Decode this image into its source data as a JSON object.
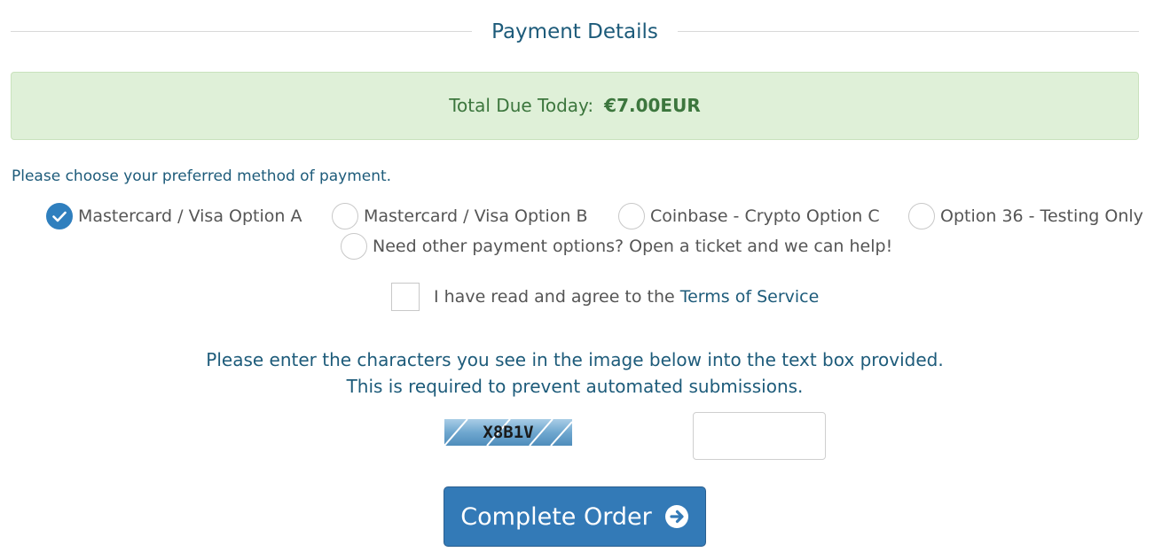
{
  "section": {
    "title": "Payment Details"
  },
  "total": {
    "label": "Total Due Today:",
    "amount": "€7.00EUR"
  },
  "payment": {
    "prompt": "Please choose your preferred method of payment.",
    "options": [
      {
        "label": "Mastercard / Visa Option A",
        "selected": true
      },
      {
        "label": "Mastercard / Visa Option B",
        "selected": false
      },
      {
        "label": "Coinbase - Crypto Option C",
        "selected": false
      },
      {
        "label": "Option 36 - Testing Only",
        "selected": false
      },
      {
        "label": "Need other payment options? Open a ticket and we can help!",
        "selected": false
      }
    ]
  },
  "terms": {
    "prefix": "I have read and agree to the",
    "link": "Terms of Service",
    "checked": false
  },
  "captcha": {
    "line1": "Please enter the characters you see in the image below into the text box provided.",
    "line2": "This is required to prevent automated submissions.",
    "image_text": "X8B1V",
    "input_value": ""
  },
  "button": {
    "complete_label": "Complete Order"
  },
  "colors": {
    "accent": "#337ab7",
    "heading": "#1d5b7a",
    "success_bg": "#dff0d8",
    "success_text": "#3c763d"
  },
  "icons": {
    "selected_radio": "checkmark-icon",
    "button_arrow": "arrow-circle-right-icon"
  }
}
